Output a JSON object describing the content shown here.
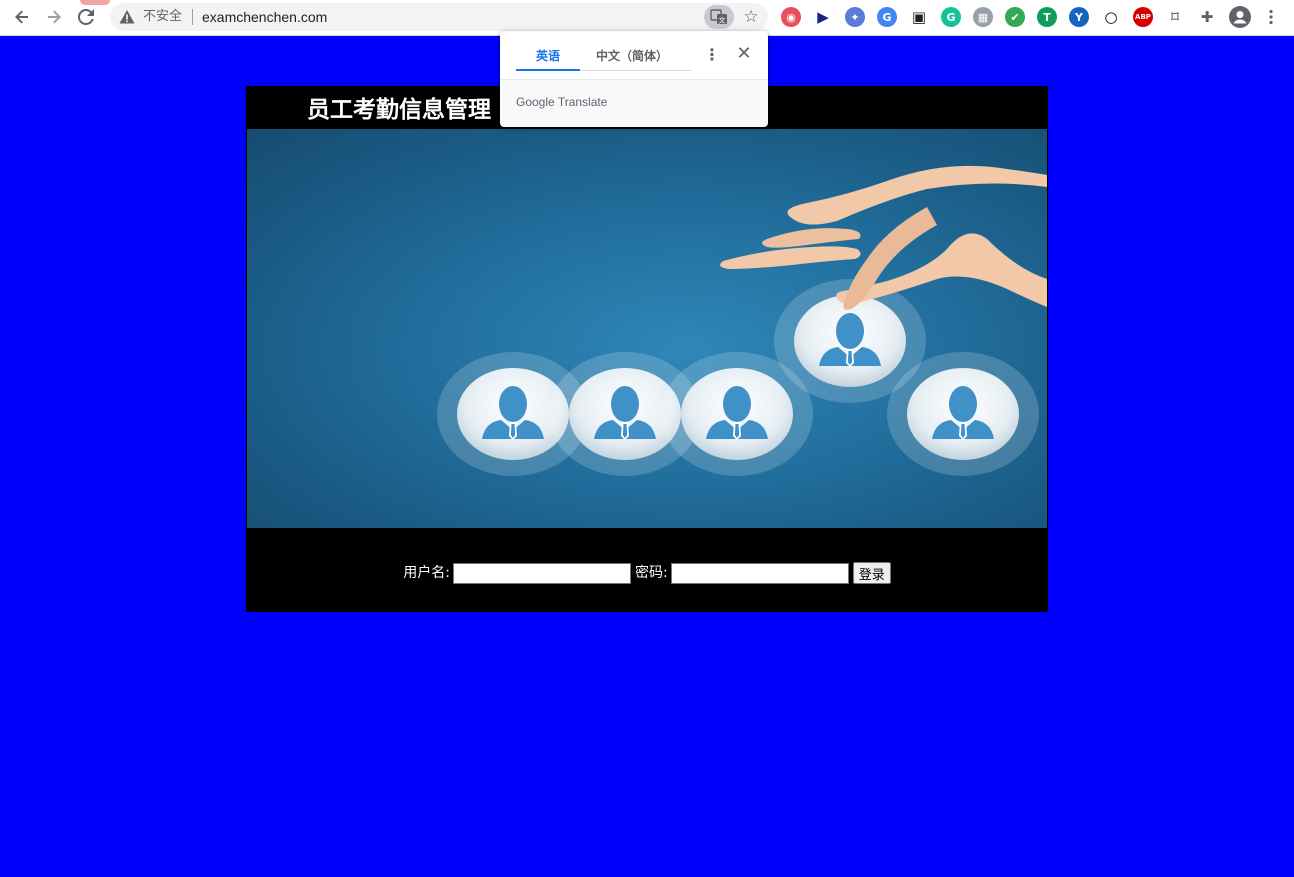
{
  "browser": {
    "security_label": "不安全",
    "url": "examchenchen.com",
    "extensions": [
      {
        "name": "shield-extension-icon",
        "color": "#e8505b",
        "glyph": "◉"
      },
      {
        "name": "cursor-extension-icon",
        "color": "#1a237e",
        "glyph": "▶"
      },
      {
        "name": "bird-extension-icon",
        "color": "#5a7bd8",
        "glyph": "✦"
      },
      {
        "name": "google-translate-extension-icon",
        "color": "#4285f4",
        "glyph": "G"
      },
      {
        "name": "picture-in-picture-extension-icon",
        "color": "#202124",
        "glyph": "▣"
      },
      {
        "name": "grammarly-extension-icon",
        "color": "#15c39a",
        "glyph": "G"
      },
      {
        "name": "tabs-extension-icon",
        "color": "#9aa0a6",
        "glyph": "▦"
      },
      {
        "name": "check-shield-extension-icon",
        "color": "#34a853",
        "glyph": "✔"
      },
      {
        "name": "t-extension-icon",
        "color": "#0f9d58",
        "glyph": "T"
      },
      {
        "name": "y-extension-icon",
        "color": "#1565c0",
        "glyph": "Y"
      },
      {
        "name": "circle-extension-icon",
        "color": "#000000",
        "glyph": "○"
      },
      {
        "name": "adblock-plus-extension-icon",
        "color": "#d40000",
        "glyph": "ABP"
      },
      {
        "name": "bookmark-extension-icon",
        "color": "#5f6368",
        "glyph": "⌑"
      },
      {
        "name": "puzzle-extensions-icon",
        "color": "#5f6368",
        "glyph": "✚"
      }
    ]
  },
  "translate_popup": {
    "tab_source": "英语",
    "tab_target": "中文（简体）",
    "brand": "Google Translate"
  },
  "page": {
    "title": "员工考勤信息管理",
    "username_label": "用户名:",
    "password_label": "密码:",
    "login_button": "登录",
    "username_value": "",
    "password_value": ""
  },
  "colors": {
    "page_background": "#0000ff",
    "container_background": "#000000",
    "accent": "#1a73e8"
  }
}
